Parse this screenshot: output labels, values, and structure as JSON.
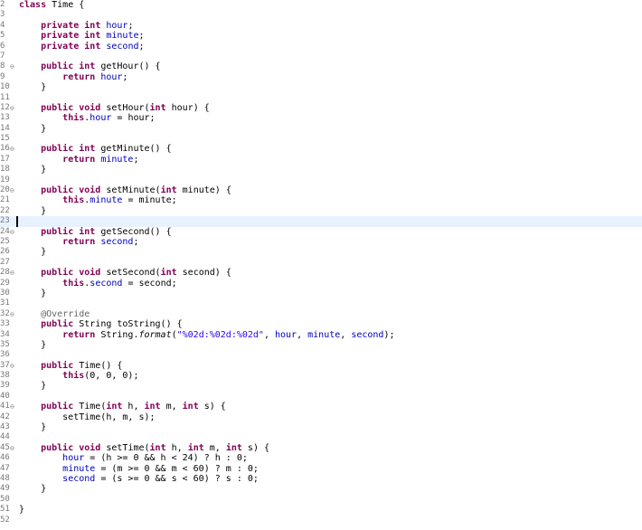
{
  "lines": [
    {
      "n": "2",
      "fold": "",
      "tokens": [
        {
          "t": "class",
          "c": "kw"
        },
        {
          "t": " Time {",
          "c": ""
        }
      ]
    },
    {
      "n": "3",
      "fold": "",
      "tokens": []
    },
    {
      "n": "4",
      "fold": "",
      "tokens": [
        {
          "t": "    ",
          "c": ""
        },
        {
          "t": "private",
          "c": "kw"
        },
        {
          "t": " ",
          "c": ""
        },
        {
          "t": "int",
          "c": "kw"
        },
        {
          "t": " ",
          "c": ""
        },
        {
          "t": "hour",
          "c": "fld"
        },
        {
          "t": ";",
          "c": ""
        }
      ]
    },
    {
      "n": "5",
      "fold": "",
      "tokens": [
        {
          "t": "    ",
          "c": ""
        },
        {
          "t": "private",
          "c": "kw"
        },
        {
          "t": " ",
          "c": ""
        },
        {
          "t": "int",
          "c": "kw"
        },
        {
          "t": " ",
          "c": ""
        },
        {
          "t": "minute",
          "c": "fld"
        },
        {
          "t": ";",
          "c": ""
        }
      ]
    },
    {
      "n": "6",
      "fold": "",
      "tokens": [
        {
          "t": "    ",
          "c": ""
        },
        {
          "t": "private",
          "c": "kw"
        },
        {
          "t": " ",
          "c": ""
        },
        {
          "t": "int",
          "c": "kw"
        },
        {
          "t": " ",
          "c": ""
        },
        {
          "t": "second",
          "c": "fld"
        },
        {
          "t": ";",
          "c": ""
        }
      ]
    },
    {
      "n": "7",
      "fold": "",
      "tokens": []
    },
    {
      "n": "8",
      "fold": "⊖",
      "tokens": [
        {
          "t": "    ",
          "c": ""
        },
        {
          "t": "public",
          "c": "kw"
        },
        {
          "t": " ",
          "c": ""
        },
        {
          "t": "int",
          "c": "kw"
        },
        {
          "t": " getHour() {",
          "c": ""
        }
      ]
    },
    {
      "n": "9",
      "fold": "",
      "tokens": [
        {
          "t": "        ",
          "c": ""
        },
        {
          "t": "return",
          "c": "kw"
        },
        {
          "t": " ",
          "c": ""
        },
        {
          "t": "hour",
          "c": "fld"
        },
        {
          "t": ";",
          "c": ""
        }
      ]
    },
    {
      "n": "10",
      "fold": "",
      "tokens": [
        {
          "t": "    }",
          "c": ""
        }
      ]
    },
    {
      "n": "11",
      "fold": "",
      "tokens": []
    },
    {
      "n": "12",
      "fold": "⊖",
      "tokens": [
        {
          "t": "    ",
          "c": ""
        },
        {
          "t": "public",
          "c": "kw"
        },
        {
          "t": " ",
          "c": ""
        },
        {
          "t": "void",
          "c": "kw"
        },
        {
          "t": " setHour(",
          "c": ""
        },
        {
          "t": "int",
          "c": "kw"
        },
        {
          "t": " hour) {",
          "c": ""
        }
      ]
    },
    {
      "n": "13",
      "fold": "",
      "tokens": [
        {
          "t": "        ",
          "c": ""
        },
        {
          "t": "this",
          "c": "kw"
        },
        {
          "t": ".",
          "c": ""
        },
        {
          "t": "hour",
          "c": "fld"
        },
        {
          "t": " = hour;",
          "c": ""
        }
      ]
    },
    {
      "n": "14",
      "fold": "",
      "tokens": [
        {
          "t": "    }",
          "c": ""
        }
      ]
    },
    {
      "n": "15",
      "fold": "",
      "tokens": []
    },
    {
      "n": "16",
      "fold": "⊖",
      "tokens": [
        {
          "t": "    ",
          "c": ""
        },
        {
          "t": "public",
          "c": "kw"
        },
        {
          "t": " ",
          "c": ""
        },
        {
          "t": "int",
          "c": "kw"
        },
        {
          "t": " getMinute() {",
          "c": ""
        }
      ]
    },
    {
      "n": "17",
      "fold": "",
      "tokens": [
        {
          "t": "        ",
          "c": ""
        },
        {
          "t": "return",
          "c": "kw"
        },
        {
          "t": " ",
          "c": ""
        },
        {
          "t": "minute",
          "c": "fld"
        },
        {
          "t": ";",
          "c": ""
        }
      ]
    },
    {
      "n": "18",
      "fold": "",
      "tokens": [
        {
          "t": "    }",
          "c": ""
        }
      ]
    },
    {
      "n": "19",
      "fold": "",
      "tokens": []
    },
    {
      "n": "20",
      "fold": "⊖",
      "tokens": [
        {
          "t": "    ",
          "c": ""
        },
        {
          "t": "public",
          "c": "kw"
        },
        {
          "t": " ",
          "c": ""
        },
        {
          "t": "void",
          "c": "kw"
        },
        {
          "t": " setMinute(",
          "c": ""
        },
        {
          "t": "int",
          "c": "kw"
        },
        {
          "t": " minute) {",
          "c": ""
        }
      ]
    },
    {
      "n": "21",
      "fold": "",
      "tokens": [
        {
          "t": "        ",
          "c": ""
        },
        {
          "t": "this",
          "c": "kw"
        },
        {
          "t": ".",
          "c": ""
        },
        {
          "t": "minute",
          "c": "fld"
        },
        {
          "t": " = minute;",
          "c": ""
        }
      ]
    },
    {
      "n": "22",
      "fold": "",
      "tokens": [
        {
          "t": "    }",
          "c": ""
        }
      ]
    },
    {
      "n": "23",
      "fold": "",
      "tokens": [],
      "current": true
    },
    {
      "n": "24",
      "fold": "⊖",
      "tokens": [
        {
          "t": "    ",
          "c": ""
        },
        {
          "t": "public",
          "c": "kw"
        },
        {
          "t": " ",
          "c": ""
        },
        {
          "t": "int",
          "c": "kw"
        },
        {
          "t": " getSecond() {",
          "c": ""
        }
      ]
    },
    {
      "n": "25",
      "fold": "",
      "tokens": [
        {
          "t": "        ",
          "c": ""
        },
        {
          "t": "return",
          "c": "kw"
        },
        {
          "t": " ",
          "c": ""
        },
        {
          "t": "second",
          "c": "fld"
        },
        {
          "t": ";",
          "c": ""
        }
      ]
    },
    {
      "n": "26",
      "fold": "",
      "tokens": [
        {
          "t": "    }",
          "c": ""
        }
      ]
    },
    {
      "n": "27",
      "fold": "",
      "tokens": []
    },
    {
      "n": "28",
      "fold": "⊖",
      "tokens": [
        {
          "t": "    ",
          "c": ""
        },
        {
          "t": "public",
          "c": "kw"
        },
        {
          "t": " ",
          "c": ""
        },
        {
          "t": "void",
          "c": "kw"
        },
        {
          "t": " setSecond(",
          "c": ""
        },
        {
          "t": "int",
          "c": "kw"
        },
        {
          "t": " second) {",
          "c": ""
        }
      ]
    },
    {
      "n": "29",
      "fold": "",
      "tokens": [
        {
          "t": "        ",
          "c": ""
        },
        {
          "t": "this",
          "c": "kw"
        },
        {
          "t": ".",
          "c": ""
        },
        {
          "t": "second",
          "c": "fld"
        },
        {
          "t": " = second;",
          "c": ""
        }
      ]
    },
    {
      "n": "30",
      "fold": "",
      "tokens": [
        {
          "t": "    }",
          "c": ""
        }
      ]
    },
    {
      "n": "31",
      "fold": "",
      "tokens": []
    },
    {
      "n": "32",
      "fold": "⊖",
      "tokens": [
        {
          "t": "    ",
          "c": ""
        },
        {
          "t": "@Override",
          "c": "ann"
        }
      ]
    },
    {
      "n": "33",
      "fold": "",
      "tokens": [
        {
          "t": "    ",
          "c": ""
        },
        {
          "t": "public",
          "c": "kw"
        },
        {
          "t": " String toString() {",
          "c": ""
        }
      ]
    },
    {
      "n": "34",
      "fold": "",
      "tokens": [
        {
          "t": "        ",
          "c": ""
        },
        {
          "t": "return",
          "c": "kw"
        },
        {
          "t": " String.",
          "c": ""
        },
        {
          "t": "format",
          "c": "ital"
        },
        {
          "t": "(",
          "c": ""
        },
        {
          "t": "\"%02d:%02d:%02d\"",
          "c": "str"
        },
        {
          "t": ", ",
          "c": ""
        },
        {
          "t": "hour",
          "c": "fld"
        },
        {
          "t": ", ",
          "c": ""
        },
        {
          "t": "minute",
          "c": "fld"
        },
        {
          "t": ", ",
          "c": ""
        },
        {
          "t": "second",
          "c": "fld"
        },
        {
          "t": ");",
          "c": ""
        }
      ]
    },
    {
      "n": "35",
      "fold": "",
      "tokens": [
        {
          "t": "    }",
          "c": ""
        }
      ]
    },
    {
      "n": "36",
      "fold": "",
      "tokens": []
    },
    {
      "n": "37",
      "fold": "⊖",
      "tokens": [
        {
          "t": "    ",
          "c": ""
        },
        {
          "t": "public",
          "c": "kw"
        },
        {
          "t": " Time() {",
          "c": ""
        }
      ]
    },
    {
      "n": "38",
      "fold": "",
      "tokens": [
        {
          "t": "        ",
          "c": ""
        },
        {
          "t": "this",
          "c": "kw"
        },
        {
          "t": "(0, 0, 0);",
          "c": ""
        }
      ]
    },
    {
      "n": "39",
      "fold": "",
      "tokens": [
        {
          "t": "    }",
          "c": ""
        }
      ]
    },
    {
      "n": "40",
      "fold": "",
      "tokens": []
    },
    {
      "n": "41",
      "fold": "⊖",
      "tokens": [
        {
          "t": "    ",
          "c": ""
        },
        {
          "t": "public",
          "c": "kw"
        },
        {
          "t": " Time(",
          "c": ""
        },
        {
          "t": "int",
          "c": "kw"
        },
        {
          "t": " h, ",
          "c": ""
        },
        {
          "t": "int",
          "c": "kw"
        },
        {
          "t": " m, ",
          "c": ""
        },
        {
          "t": "int",
          "c": "kw"
        },
        {
          "t": " s) {",
          "c": ""
        }
      ]
    },
    {
      "n": "42",
      "fold": "",
      "tokens": [
        {
          "t": "        setTime(h, m, s);",
          "c": ""
        }
      ]
    },
    {
      "n": "43",
      "fold": "",
      "tokens": [
        {
          "t": "    }",
          "c": ""
        }
      ]
    },
    {
      "n": "44",
      "fold": "",
      "tokens": []
    },
    {
      "n": "45",
      "fold": "⊖",
      "tokens": [
        {
          "t": "    ",
          "c": ""
        },
        {
          "t": "public",
          "c": "kw"
        },
        {
          "t": " ",
          "c": ""
        },
        {
          "t": "void",
          "c": "kw"
        },
        {
          "t": " setTime(",
          "c": ""
        },
        {
          "t": "int",
          "c": "kw"
        },
        {
          "t": " h, ",
          "c": ""
        },
        {
          "t": "int",
          "c": "kw"
        },
        {
          "t": " m, ",
          "c": ""
        },
        {
          "t": "int",
          "c": "kw"
        },
        {
          "t": " s) {",
          "c": ""
        }
      ]
    },
    {
      "n": "46",
      "fold": "",
      "tokens": [
        {
          "t": "        ",
          "c": ""
        },
        {
          "t": "hour",
          "c": "fld"
        },
        {
          "t": " = (h >= 0 && h < 24) ? h : 0;",
          "c": ""
        }
      ]
    },
    {
      "n": "47",
      "fold": "",
      "tokens": [
        {
          "t": "        ",
          "c": ""
        },
        {
          "t": "minute",
          "c": "fld"
        },
        {
          "t": " = (m >= 0 && m < 60) ? m : 0;",
          "c": ""
        }
      ]
    },
    {
      "n": "48",
      "fold": "",
      "tokens": [
        {
          "t": "        ",
          "c": ""
        },
        {
          "t": "second",
          "c": "fld"
        },
        {
          "t": " = (s >= 0 && s < 60) ? s : 0;",
          "c": ""
        }
      ]
    },
    {
      "n": "49",
      "fold": "",
      "tokens": [
        {
          "t": "    }",
          "c": ""
        }
      ]
    },
    {
      "n": "50",
      "fold": "",
      "tokens": []
    },
    {
      "n": "51",
      "fold": "",
      "tokens": [
        {
          "t": "}",
          "c": ""
        }
      ]
    },
    {
      "n": "52",
      "fold": "",
      "tokens": []
    }
  ]
}
